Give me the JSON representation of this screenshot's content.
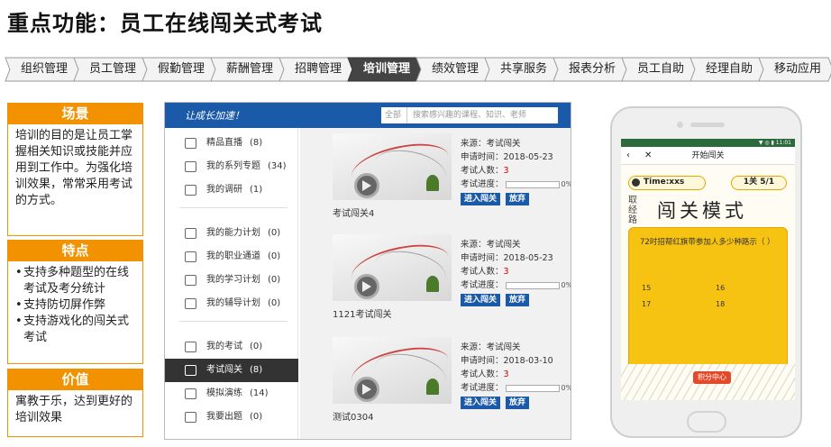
{
  "title": "重点功能：员工在线闯关式考试",
  "nav": {
    "items": [
      "组织管理",
      "员工管理",
      "假勤管理",
      "薪酬管理",
      "招聘管理",
      "培训管理",
      "绩效管理",
      "共享服务",
      "报表分析",
      "员工自助",
      "经理自助",
      "移动应用"
    ],
    "active_index": 5
  },
  "panel": {
    "scene_title": "场景",
    "scene_text": "培训的目的是让员工掌握相关知识或技能并应用到工作中。为强化培训效果，常常采用考试的方式。",
    "features_title": "特点",
    "features": [
      "支持多种题型的在线考试及考分统计",
      "支持防切屏作弊",
      "支持游戏化的闯关式考试"
    ],
    "value_title": "价值",
    "value_text": "寓教于乐，达到更好的培训效果"
  },
  "web": {
    "logo": "让成长加速！",
    "search_cat": "全部",
    "search_placeholder": "搜索感兴趣的课程、知识、老师",
    "sidebar": [
      {
        "label": "精品直播",
        "count": "(8)",
        "icon": "live-icon"
      },
      {
        "label": "我的系列专题",
        "count": "(34)",
        "icon": "series-icon"
      },
      {
        "label": "我的调研",
        "count": "(1)",
        "icon": "survey-icon"
      },
      {
        "label": "我的能力计划",
        "count": "(0)",
        "icon": "ability-icon"
      },
      {
        "label": "我的职业通道",
        "count": "(0)",
        "icon": "career-icon"
      },
      {
        "label": "我的学习计划",
        "count": "(0)",
        "icon": "study-plan-icon"
      },
      {
        "label": "我的辅导计划",
        "count": "(0)",
        "icon": "coaching-icon"
      },
      {
        "label": "我的考试",
        "count": "(0)",
        "icon": "exam-icon"
      },
      {
        "label": "考试闯关",
        "count": "(8)",
        "icon": "exam-challenge-icon"
      },
      {
        "label": "模拟演练",
        "count": "(14)",
        "icon": "practice-icon"
      },
      {
        "label": "我要出题",
        "count": "(0)",
        "icon": "question-icon"
      }
    ],
    "active_sidebar": 8,
    "cards": [
      {
        "name": "考试闯关4",
        "source_label": "来源：",
        "source": "考试闯关",
        "date_label": "申请时间：",
        "date": "2018-05-23",
        "people_label": "考试人数：",
        "people": "3",
        "progress_label": "考试进度：",
        "progress": "0%",
        "enter": "进入闯关",
        "quit": "放弃"
      },
      {
        "name": "1121考试闯关",
        "source_label": "来源：",
        "source": "考试闯关",
        "date_label": "申请时间：",
        "date": "2018-05-23",
        "people_label": "考试人数：",
        "people": "3",
        "progress_label": "考试进度：",
        "progress": "0%",
        "enter": "进入闯关",
        "quit": "放弃"
      },
      {
        "name": "测试0304",
        "source_label": "来源：",
        "source": "考试闯关",
        "date_label": "申请时间：",
        "date": "2018-03-10",
        "people_label": "考试人数：",
        "people": "3",
        "progress_label": "考试进度：",
        "progress": "0%",
        "enter": "进入闯关",
        "quit": "放弃"
      }
    ]
  },
  "phone": {
    "status": "▼ ◎ ▮ 11:01",
    "nav_title": "开始闯关",
    "time": "Time:xxs",
    "level": "1关 5/1",
    "side_text": "取经路",
    "mode_title": "闯关模式",
    "question": "72时招帮红旗带参加人多少种路示（ ）",
    "options": [
      "15",
      "16",
      "17",
      "18"
    ],
    "center_btn": "积分中心",
    "accent": "#f7c313"
  }
}
